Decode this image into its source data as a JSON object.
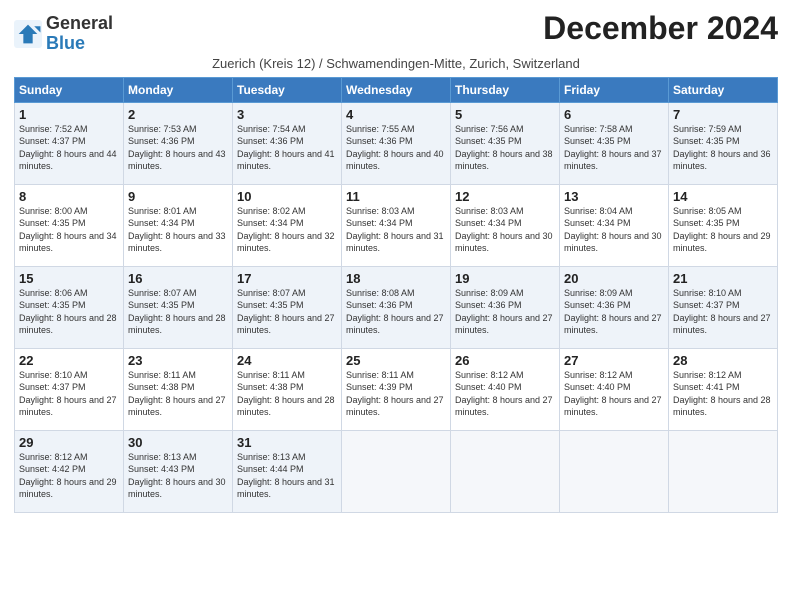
{
  "header": {
    "logo_general": "General",
    "logo_blue": "Blue",
    "month_title": "December 2024",
    "subtitle": "Zuerich (Kreis 12) / Schwamendingen-Mitte, Zurich, Switzerland"
  },
  "days_of_week": [
    "Sunday",
    "Monday",
    "Tuesday",
    "Wednesday",
    "Thursday",
    "Friday",
    "Saturday"
  ],
  "weeks": [
    [
      {
        "day": "1",
        "sunrise": "7:52 AM",
        "sunset": "4:37 PM",
        "daylight": "8 hours and 44 minutes."
      },
      {
        "day": "2",
        "sunrise": "7:53 AM",
        "sunset": "4:36 PM",
        "daylight": "8 hours and 43 minutes."
      },
      {
        "day": "3",
        "sunrise": "7:54 AM",
        "sunset": "4:36 PM",
        "daylight": "8 hours and 41 minutes."
      },
      {
        "day": "4",
        "sunrise": "7:55 AM",
        "sunset": "4:36 PM",
        "daylight": "8 hours and 40 minutes."
      },
      {
        "day": "5",
        "sunrise": "7:56 AM",
        "sunset": "4:35 PM",
        "daylight": "8 hours and 38 minutes."
      },
      {
        "day": "6",
        "sunrise": "7:58 AM",
        "sunset": "4:35 PM",
        "daylight": "8 hours and 37 minutes."
      },
      {
        "day": "7",
        "sunrise": "7:59 AM",
        "sunset": "4:35 PM",
        "daylight": "8 hours and 36 minutes."
      }
    ],
    [
      {
        "day": "8",
        "sunrise": "8:00 AM",
        "sunset": "4:35 PM",
        "daylight": "8 hours and 34 minutes."
      },
      {
        "day": "9",
        "sunrise": "8:01 AM",
        "sunset": "4:34 PM",
        "daylight": "8 hours and 33 minutes."
      },
      {
        "day": "10",
        "sunrise": "8:02 AM",
        "sunset": "4:34 PM",
        "daylight": "8 hours and 32 minutes."
      },
      {
        "day": "11",
        "sunrise": "8:03 AM",
        "sunset": "4:34 PM",
        "daylight": "8 hours and 31 minutes."
      },
      {
        "day": "12",
        "sunrise": "8:03 AM",
        "sunset": "4:34 PM",
        "daylight": "8 hours and 30 minutes."
      },
      {
        "day": "13",
        "sunrise": "8:04 AM",
        "sunset": "4:34 PM",
        "daylight": "8 hours and 30 minutes."
      },
      {
        "day": "14",
        "sunrise": "8:05 AM",
        "sunset": "4:35 PM",
        "daylight": "8 hours and 29 minutes."
      }
    ],
    [
      {
        "day": "15",
        "sunrise": "8:06 AM",
        "sunset": "4:35 PM",
        "daylight": "8 hours and 28 minutes."
      },
      {
        "day": "16",
        "sunrise": "8:07 AM",
        "sunset": "4:35 PM",
        "daylight": "8 hours and 28 minutes."
      },
      {
        "day": "17",
        "sunrise": "8:07 AM",
        "sunset": "4:35 PM",
        "daylight": "8 hours and 27 minutes."
      },
      {
        "day": "18",
        "sunrise": "8:08 AM",
        "sunset": "4:36 PM",
        "daylight": "8 hours and 27 minutes."
      },
      {
        "day": "19",
        "sunrise": "8:09 AM",
        "sunset": "4:36 PM",
        "daylight": "8 hours and 27 minutes."
      },
      {
        "day": "20",
        "sunrise": "8:09 AM",
        "sunset": "4:36 PM",
        "daylight": "8 hours and 27 minutes."
      },
      {
        "day": "21",
        "sunrise": "8:10 AM",
        "sunset": "4:37 PM",
        "daylight": "8 hours and 27 minutes."
      }
    ],
    [
      {
        "day": "22",
        "sunrise": "8:10 AM",
        "sunset": "4:37 PM",
        "daylight": "8 hours and 27 minutes."
      },
      {
        "day": "23",
        "sunrise": "8:11 AM",
        "sunset": "4:38 PM",
        "daylight": "8 hours and 27 minutes."
      },
      {
        "day": "24",
        "sunrise": "8:11 AM",
        "sunset": "4:38 PM",
        "daylight": "8 hours and 28 minutes."
      },
      {
        "day": "25",
        "sunrise": "8:11 AM",
        "sunset": "4:39 PM",
        "daylight": "8 hours and 27 minutes."
      },
      {
        "day": "26",
        "sunrise": "8:12 AM",
        "sunset": "4:40 PM",
        "daylight": "8 hours and 27 minutes."
      },
      {
        "day": "27",
        "sunrise": "8:12 AM",
        "sunset": "4:40 PM",
        "daylight": "8 hours and 27 minutes."
      },
      {
        "day": "28",
        "sunrise": "8:12 AM",
        "sunset": "4:41 PM",
        "daylight": "8 hours and 28 minutes."
      }
    ],
    [
      {
        "day": "29",
        "sunrise": "8:12 AM",
        "sunset": "4:42 PM",
        "daylight": "8 hours and 29 minutes."
      },
      {
        "day": "30",
        "sunrise": "8:13 AM",
        "sunset": "4:43 PM",
        "daylight": "8 hours and 30 minutes."
      },
      {
        "day": "31",
        "sunrise": "8:13 AM",
        "sunset": "4:44 PM",
        "daylight": "8 hours and 31 minutes."
      },
      null,
      null,
      null,
      null
    ]
  ],
  "labels": {
    "sunrise": "Sunrise: ",
    "sunset": "Sunset: ",
    "daylight": "Daylight: "
  }
}
